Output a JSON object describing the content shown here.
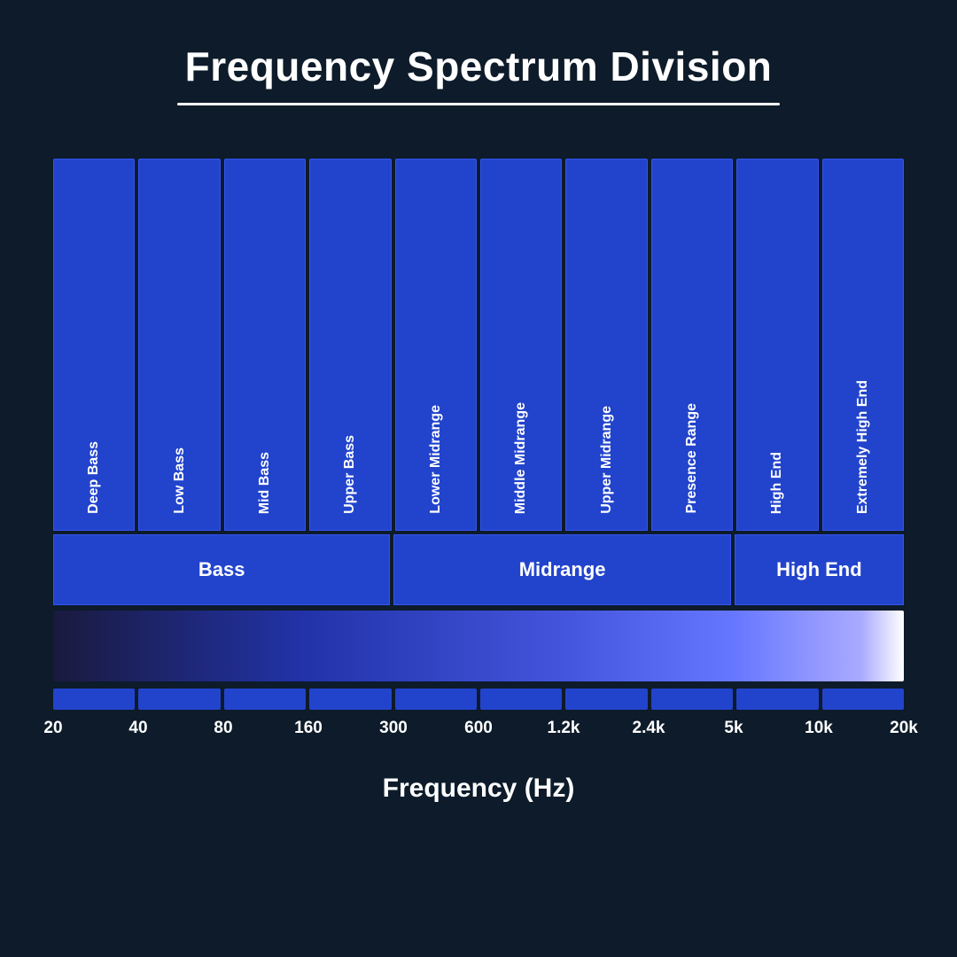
{
  "title": "Frequency Spectrum Division",
  "bands": [
    {
      "label": "Deep Bass"
    },
    {
      "label": "Low Bass"
    },
    {
      "label": "Mid Bass"
    },
    {
      "label": "Upper Bass"
    },
    {
      "label": "Lower Midrange"
    },
    {
      "label": "Middle Midrange"
    },
    {
      "label": "Upper Midrange"
    },
    {
      "label": "Presence Range"
    },
    {
      "label": "High End"
    },
    {
      "label": "Extremely High End"
    }
  ],
  "groups": [
    {
      "label": "Bass",
      "class": "group-bass"
    },
    {
      "label": "Midrange",
      "class": "group-midrange"
    },
    {
      "label": "High End",
      "class": "group-highend"
    }
  ],
  "freq_labels": [
    "20",
    "40",
    "80",
    "160",
    "300",
    "600",
    "1.2k",
    "2.4k",
    "5k",
    "10k",
    "20k"
  ],
  "x_axis_title": "Frequency (Hz)",
  "colors": {
    "background": "#0d1b2a",
    "band_fill": "#2244cc",
    "band_border": "#3355ee",
    "text": "#ffffff"
  }
}
